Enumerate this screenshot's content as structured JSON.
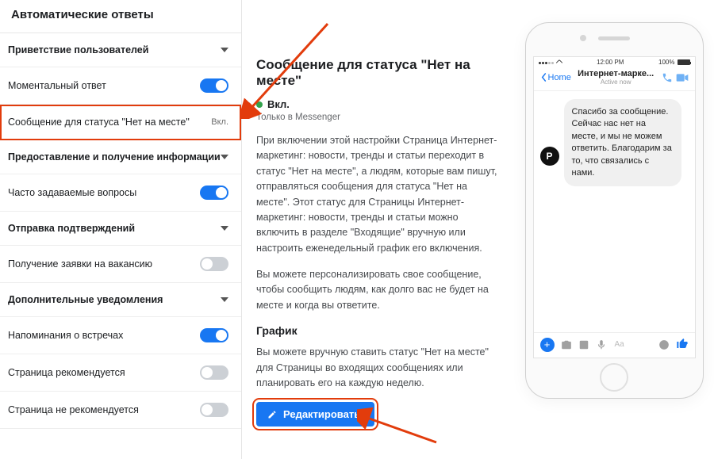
{
  "sidebar": {
    "title": "Автоматические ответы",
    "sections": [
      {
        "label": "Приветствие пользователей"
      },
      {
        "label": "Предоставление и получение информации"
      },
      {
        "label": "Отправка подтверждений"
      },
      {
        "label": "Дополнительные уведомления"
      }
    ],
    "rows": {
      "instant": "Моментальный ответ",
      "away_msg": "Сообщение для статуса \"Нет на месте\"",
      "away_msg_status": "Вкл.",
      "faq": "Часто задаваемые вопросы",
      "vacancy": "Получение заявки на вакансию",
      "meetings": "Напоминания о встречах",
      "page_rec": "Страница рекомендуется",
      "page_notrec": "Страница не рекомендуется"
    }
  },
  "main": {
    "title": "Сообщение для статуса \"Нет на месте\"",
    "status": "Вкл.",
    "sub": "Только в Messenger",
    "desc1": "При включении этой настройки Страница Интернет-маркетинг: новости, тренды и статьи переходит в статус \"Нет на месте\", а людям, которые вам пишут, отправляться сообщения для статуса \"Нет на месте\". Этот статус для Страницы Интернет-маркетинг: новости, тренды и статьи можно включить в разделе \"Входящие\" вручную или настроить еженедельный график его включения.",
    "desc2": "Вы можете персонализировать свое сообщение, чтобы сообщить людям, как долго вас не будет на месте и когда вы ответите.",
    "schedule_title": "График",
    "schedule_desc": "Вы можете вручную ставить статус \"Нет на месте\" для Страницы во входящих сообщениях или планировать его на каждую неделю.",
    "edit_button": "Редактировать"
  },
  "phone": {
    "time": "12:00 PM",
    "battery": "100%",
    "home": "Home",
    "chat_name": "Интернет-марке...",
    "active": "Active now",
    "avatar": "P",
    "bubble": "Спасибо за сообщение. Сейчас нас нет на месте, и мы не можем ответить. Благодарим за то, что связались с нами.",
    "input_placeholder": "Aa"
  }
}
